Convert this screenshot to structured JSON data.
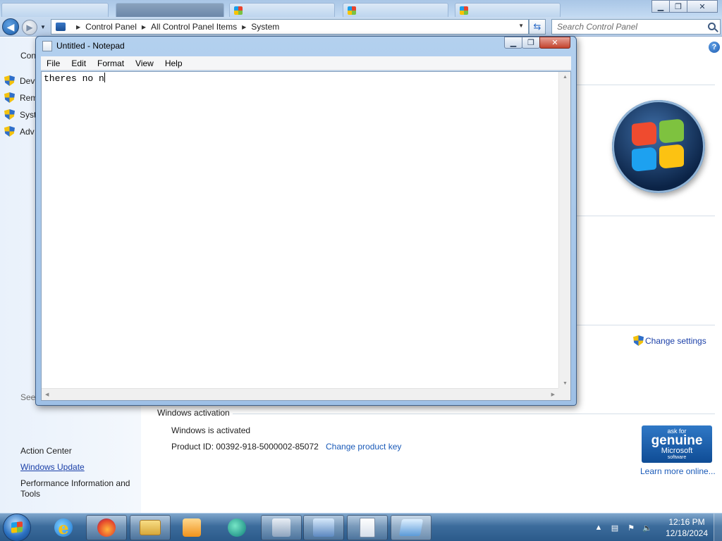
{
  "control_panel": {
    "breadcrumb": [
      "Control Panel",
      "All Control Panel Items",
      "System"
    ],
    "search_placeholder": "Search Control Panel",
    "sidebar": {
      "home_label_partial": "Con",
      "links": [
        "Dev",
        "Rem",
        "Syst",
        "Adv"
      ],
      "see_also_heading": "See also",
      "see_also": [
        "Action Center",
        "Windows Update",
        "Performance Information and Tools"
      ]
    },
    "change_settings": "Change settings",
    "activation": {
      "heading": "Windows activation",
      "status": "Windows is activated",
      "product_id": "Product ID: 00392-918-5000002-85072",
      "change_key": "Change product key",
      "badge": {
        "line1": "ask for",
        "line2": "genuine",
        "line3": "Microsoft",
        "line4": "software"
      },
      "learn_more": "Learn more online..."
    }
  },
  "notepad": {
    "title": "Untitled - Notepad",
    "menu": [
      "File",
      "Edit",
      "Format",
      "View",
      "Help"
    ],
    "content": "theres no n"
  },
  "taskbar": {
    "apps": [
      "Internet Explorer",
      "Firefox",
      "Windows Explorer",
      "Media Player",
      "Edge",
      "Tool",
      "Network",
      "Notepad",
      "Control Panel"
    ],
    "clock": {
      "time": "12:16 PM",
      "date": "12/18/2024"
    }
  }
}
